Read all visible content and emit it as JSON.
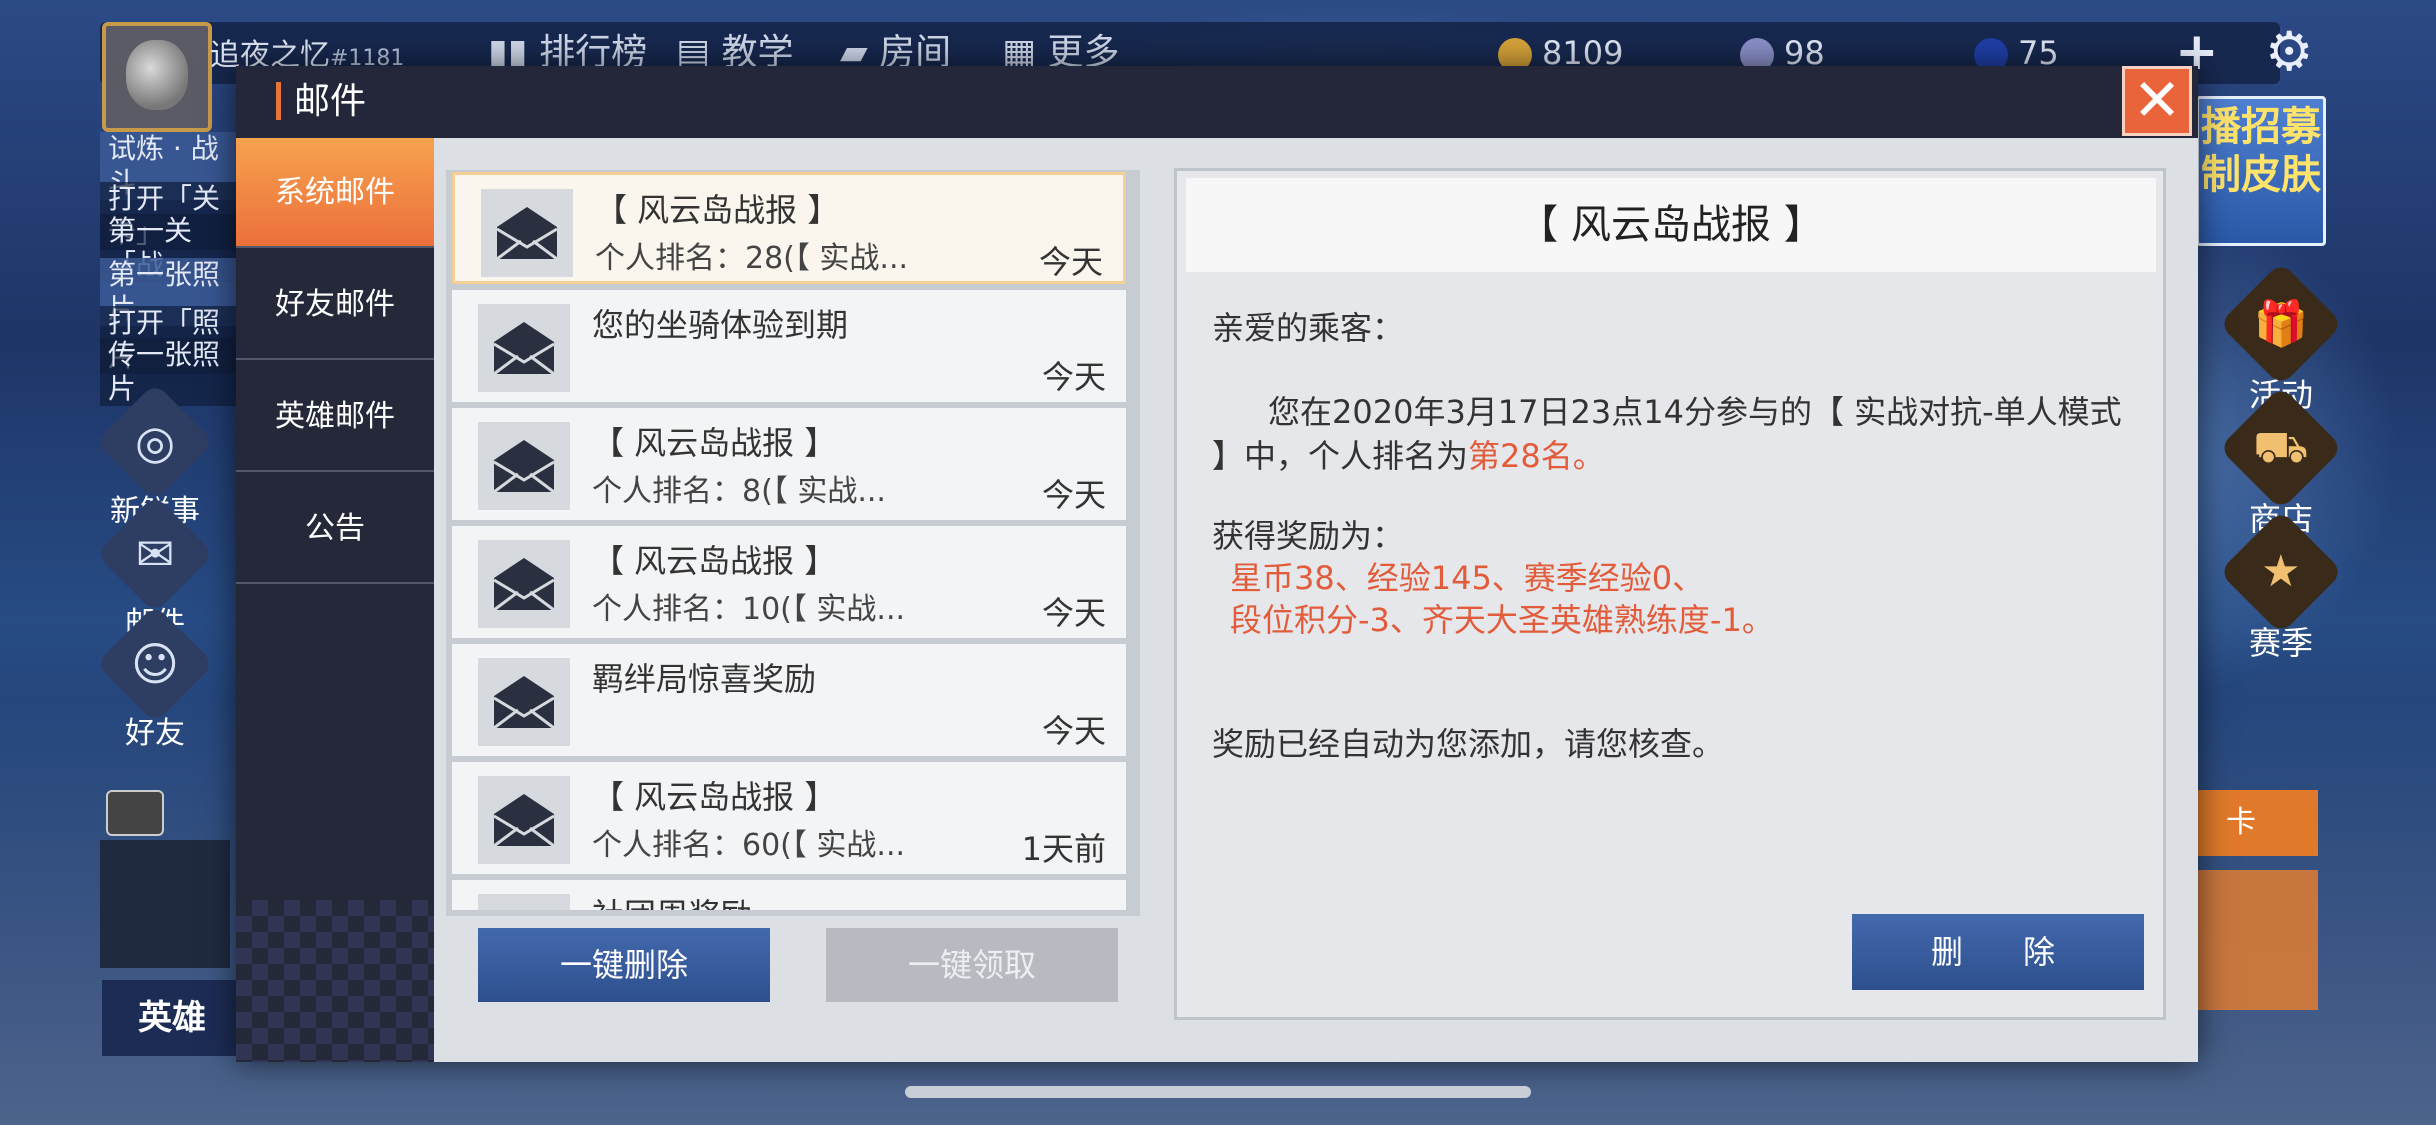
{
  "hud": {
    "player_name": "追夜之忆",
    "player_id": "#1181",
    "tabs": [
      "排行榜",
      "教学",
      "房间",
      "更多"
    ],
    "gold": "8109",
    "crystal": "98",
    "gem": "75",
    "quest": {
      "head1": "试炼 · 战斗",
      "line1": "打开「关卡」",
      "line2": "第一关「战",
      "head2": "第一张照片",
      "line3": "打开「照片",
      "line4": "传一张照片"
    },
    "left_side": [
      {
        "label": "新鲜事",
        "icon": "camera-icon"
      },
      {
        "label": "邮件",
        "icon": "mail-icon"
      },
      {
        "label": "好友",
        "icon": "friends-icon"
      }
    ],
    "right_side": [
      {
        "label": "活动",
        "icon": "gift-icon"
      },
      {
        "label": "商店",
        "icon": "shop-bag-icon"
      },
      {
        "label": "赛季",
        "icon": "season-star-icon"
      }
    ],
    "banner_text": "播招募 制皮肤",
    "right_card": "卡",
    "left_strip": "英雄"
  },
  "mail": {
    "title": "邮件",
    "tabs": [
      "系统邮件",
      "好友邮件",
      "英雄邮件",
      "公告"
    ],
    "active_tab": 0,
    "items": [
      {
        "title": "【 风云岛战报 】",
        "sub": "个人排名：28(【 实战...",
        "time": "今天",
        "selected": true
      },
      {
        "title": "您的坐骑体验到期",
        "sub": "",
        "time": "今天",
        "selected": false
      },
      {
        "title": "【 风云岛战报 】",
        "sub": "个人排名：8(【 实战...",
        "time": "今天",
        "selected": false
      },
      {
        "title": "【 风云岛战报 】",
        "sub": "个人排名：10(【 实战...",
        "time": "今天",
        "selected": false
      },
      {
        "title": "羁绊局惊喜奖励",
        "sub": "",
        "time": "今天",
        "selected": false
      },
      {
        "title": "【 风云岛战报 】",
        "sub": "个人排名：60(【 实战...",
        "time": "1天前",
        "selected": false
      },
      {
        "title": "社团周奖励",
        "sub": "",
        "time": "",
        "selected": false
      }
    ],
    "delete_all": "一键删除",
    "claim_all": "一键领取",
    "detail": {
      "title": "【 风云岛战报 】",
      "greeting": "亲爱的乘客：",
      "body_a": "您在2020年3月17日23点14分参与的【 实战对抗-单人模式 】中，个人排名为",
      "body_rank": "第28名。",
      "reward_label": "获得奖励为：",
      "reward_line1": "星币38、经验145、赛季经验0、",
      "reward_line2": "段位积分-3、齐天大圣英雄熟练度-1。",
      "footer": "奖励已经自动为您添加，请您核查。",
      "delete_button": "删除"
    }
  },
  "colors": {
    "accent_orange": "#ec6f3b",
    "button_blue": "#2d4f8d",
    "reward_red": "#e25c3c"
  }
}
